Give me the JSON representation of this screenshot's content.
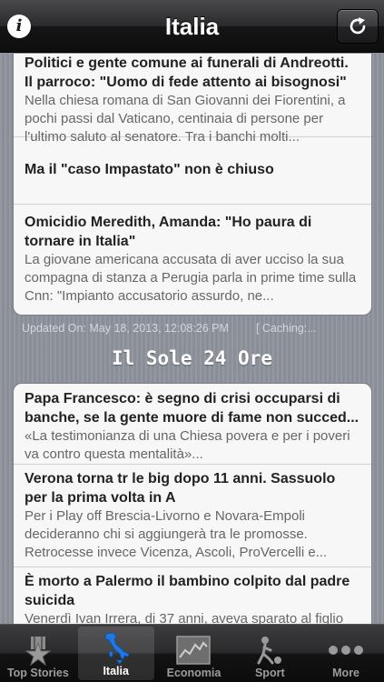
{
  "navbar": {
    "title": "Italia",
    "info_icon": "i",
    "refresh_icon": "refresh-icon"
  },
  "sections": [
    {
      "items": [
        {
          "title": "Politici e gente comune ai funerali di Andreotti. Il parroco: \"Uomo di fede attento ai bisognosi\"",
          "description": "Nella chiesa romana di San Giovanni dei Fiorentini, a pochi passi dal Vaticano, centinaia di persone per l'ultimo saluto al senatore. Tra i banchi molti..."
        },
        {
          "title": "Ma il \"caso Impastato\" non è chiuso",
          "description": ""
        },
        {
          "title": "Omicidio Meredith, Amanda: \"Ho paura di tornare in Italia\"",
          "description": "La giovane americana accusata di aver ucciso la sua compagna di stanza a Perugia parla in prime time sulla Cnn: \"Impianto accusatorio assurdo, ne..."
        }
      ],
      "updated": "Updated On: May 18, 2013, 12:08:26 PM",
      "caching": "[ Caching:..."
    },
    {
      "title": "Il Sole 24 Ore",
      "items": [
        {
          "title": "Papa Francesco: è segno di crisi occuparsi di banche, se la gente muore di fame non succed...",
          "description": "«La testimonianza di una Chiesa povera e per i poveri va contro questa mentalità»..."
        },
        {
          "title": "Verona torna tr le big dopo 11 anni. Sassuolo per la prima volta in A",
          "description": "Per i Play off Brescia-Livorno e Novara-Empoli decideranno chi si aggiungerà tra le promosse. Retrocesse invece Vicenza, Ascoli, ProVercelli e..."
        },
        {
          "title": "È morto a Palermo il bambino colpito dal padre suicida",
          "description": "Venerdì Ivan Irrera, di 37 anni, aveva sparato al figlio"
        }
      ]
    }
  ],
  "tabbar": {
    "selected": "Italia",
    "tabs": [
      {
        "label": "Top Stories",
        "icon": "star-icon"
      },
      {
        "label": "Italia",
        "icon": "italy-map-icon"
      },
      {
        "label": "Economia",
        "icon": "stock-chart-icon"
      },
      {
        "label": "Sport",
        "icon": "sport-icon"
      },
      {
        "label": "More",
        "icon": "more-icon"
      }
    ]
  }
}
